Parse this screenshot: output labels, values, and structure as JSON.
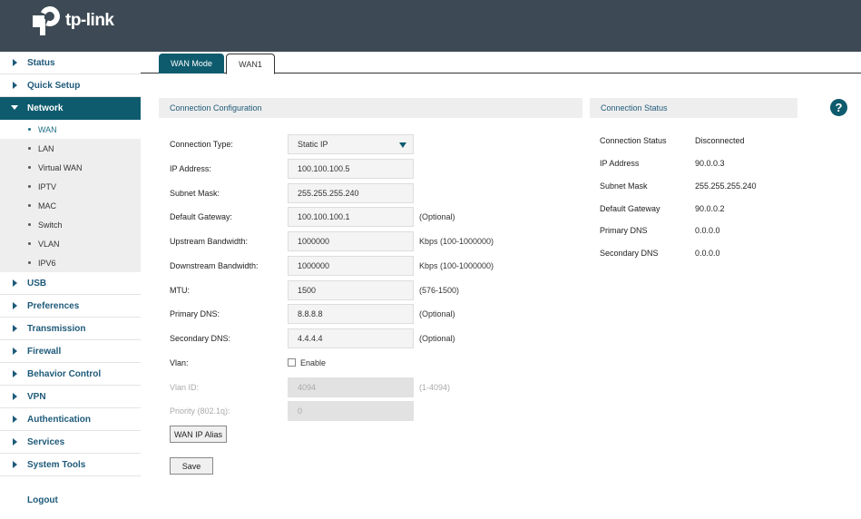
{
  "header": {
    "logo_text": "tp-link",
    "bg_color": "#3d4a55"
  },
  "sidebar": {
    "items": [
      {
        "label": "Status"
      },
      {
        "label": "Quick Setup"
      },
      {
        "label": "Network",
        "active": true
      },
      {
        "label": "USB"
      },
      {
        "label": "Preferences"
      },
      {
        "label": "Transmission"
      },
      {
        "label": "Firewall"
      },
      {
        "label": "Behavior Control"
      },
      {
        "label": "VPN"
      },
      {
        "label": "Authentication"
      },
      {
        "label": "Services"
      },
      {
        "label": "System Tools"
      }
    ],
    "network_sub": [
      "WAN",
      "LAN",
      "Virtual WAN",
      "IPTV",
      "MAC",
      "Switch",
      "VLAN",
      "IPV6"
    ],
    "logout": "Logout"
  },
  "tabs": {
    "wan_mode": "WAN Mode",
    "wan1": "WAN1"
  },
  "config": {
    "title": "Connection Configuration",
    "connection_type": {
      "label": "Connection Type:",
      "value": "Static IP"
    },
    "ip_address": {
      "label": "IP Address:",
      "value": "100.100.100.5"
    },
    "subnet_mask": {
      "label": "Subnet Mask:",
      "value": "255.255.255.240"
    },
    "default_gateway": {
      "label": "Default Gateway:",
      "value": "100.100.100.1",
      "hint": "(Optional)"
    },
    "upstream": {
      "label": "Upstream Bandwidth:",
      "value": "1000000",
      "hint": "Kbps (100-1000000)"
    },
    "downstream": {
      "label": "Downstream Bandwidth:",
      "value": "1000000",
      "hint": "Kbps (100-1000000)"
    },
    "mtu": {
      "label": "MTU:",
      "value": "1500",
      "hint": "(576-1500)"
    },
    "primary_dns": {
      "label": "Primary DNS:",
      "value": "8.8.8.8",
      "hint": "(Optional)"
    },
    "secondary_dns": {
      "label": "Secondary DNS:",
      "value": "4.4.4.4",
      "hint": "(Optional)"
    },
    "vlan": {
      "label": "Vlan:",
      "checkbox_label": "Enable",
      "checked": false
    },
    "vlan_id": {
      "label": "Vlan ID:",
      "value": "4094",
      "hint": "(1-4094)"
    },
    "priority": {
      "label": "Priority (802.1q):",
      "value": "0"
    },
    "alias_button": "WAN IP Alias",
    "save_button": "Save"
  },
  "status": {
    "title": "Connection Status",
    "rows": [
      {
        "k": "Connection Status",
        "v": "Disconnected"
      },
      {
        "k": "IP Address",
        "v": "90.0.0.3"
      },
      {
        "k": "Subnet Mask",
        "v": "255.255.255.240"
      },
      {
        "k": "Default Gateway",
        "v": "90.0.0.2"
      },
      {
        "k": "Primary DNS",
        "v": "0.0.0.0"
      },
      {
        "k": "Secondary DNS",
        "v": "0.0.0.0"
      }
    ]
  },
  "help_icon": "question-icon",
  "accent_color": "#0e5b6e"
}
